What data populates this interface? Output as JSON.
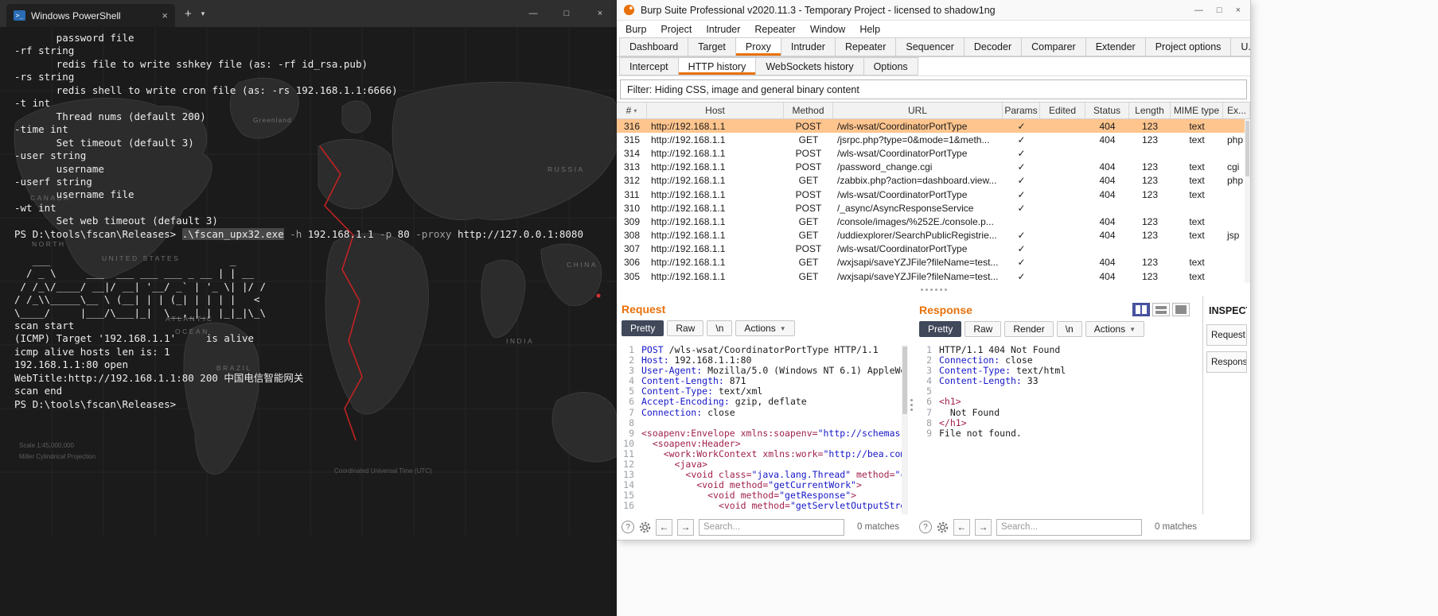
{
  "terminal": {
    "tab_bar": {
      "title": "Windows PowerShell",
      "ps_icon": ">_",
      "close": "×",
      "new_tab": "+",
      "dropdown": "▾",
      "controls": {
        "minimize": "—",
        "maximize": "□",
        "close": "×"
      }
    },
    "help_lines": [
      "       password file",
      "-rf string",
      "       redis file to write sshkey file (as: -rf id_rsa.pub)",
      "-rs string",
      "       redis shell to write cron file (as: -rs 192.168.1.1:6666)",
      "-t int",
      "       Thread nums (default 200)",
      "-time int",
      "       Set timeout (default 3)",
      "-user string",
      "       username",
      "-userf string",
      "       username file",
      "-wt int",
      "       Set web timeout (default 3)"
    ],
    "command_segments": [
      {
        "t": "PS D:\\tools\\fscan\\Releases> ",
        "c": "plain"
      },
      {
        "t": ".\\fscan_upx32.exe",
        "c": "cmd"
      },
      {
        "t": " ",
        "c": "plain"
      },
      {
        "t": "-h",
        "c": "param"
      },
      {
        "t": " 192.168.1.1 ",
        "c": "plain"
      },
      {
        "t": "-p",
        "c": "param"
      },
      {
        "t": " 80 ",
        "c": "plain"
      },
      {
        "t": "-proxy",
        "c": "param"
      },
      {
        "t": " http://127.0.0.1:8080",
        "c": "plain"
      }
    ],
    "banner_lines": [
      "",
      "   ___                              _",
      "  / _ \\     ___  ___ ___ ___ _ __ | | __",
      " / /_\\/____/ __|/ __| '__/ _` | '_ \\| |/ /",
      "/ /_\\\\_____\\__ \\ (__| | | (_| | | | |   < ",
      "\\____/     |___/\\___|_|  \\__,_|_| |_|_|\\_\\",
      ""
    ],
    "output_lines": [
      "scan start",
      "(ICMP) Target '192.168.1.1'     is alive",
      "icmp alive hosts len is: 1",
      "192.168.1.1:80 open",
      "WebTitle:http://192.168.1.1:80 200 中国电信智能网关",
      "scan end",
      "PS D:\\tools\\fscan\\Releases>"
    ],
    "map": {
      "labels": [
        "Greenland",
        "CANADA",
        "NORTH",
        "UNITED STATES",
        "RUSSIA",
        "CHINA",
        "INDIA",
        "BRAZIL",
        "ATLANTIC",
        "OCEAN"
      ],
      "captions": [
        "Scale 1:45,000,000",
        "Miller Cylindrical Projection",
        "Coordinated Universal Time (UTC)"
      ]
    }
  },
  "burp": {
    "title_bar": {
      "title": "Burp Suite Professional v2020.11.3 - Temporary Project - licensed to shadow1ng"
    },
    "window_controls": {
      "minimize": "—",
      "maximize": "□",
      "close": "×"
    },
    "menu": [
      "Burp",
      "Project",
      "Intruder",
      "Repeater",
      "Window",
      "Help"
    ],
    "main_tabs": [
      "Dashboard",
      "Target",
      "Proxy",
      "Intruder",
      "Repeater",
      "Sequencer",
      "Decoder",
      "Comparer",
      "Extender",
      "Project options",
      "U..."
    ],
    "sub_tabs": [
      "Intercept",
      "HTTP history",
      "WebSockets history",
      "Options"
    ],
    "filter_bar": "Filter: Hiding CSS, image and general binary content",
    "table": {
      "columns": [
        "#",
        "Host",
        "Method",
        "URL",
        "Params",
        "Edited",
        "Status",
        "Length",
        "MIME type",
        "Ex..."
      ],
      "rows": [
        {
          "num": "316",
          "host": "http://192.168.1.1",
          "method": "POST",
          "url": "/wls-wsat/CoordinatorPortType",
          "params": "✓",
          "edited": "",
          "status": "404",
          "length": "123",
          "mime": "text",
          "ext": "",
          "selected": true
        },
        {
          "num": "315",
          "host": "http://192.168.1.1",
          "method": "GET",
          "url": "/jsrpc.php?type=0&mode=1&meth...",
          "params": "✓",
          "edited": "",
          "status": "404",
          "length": "123",
          "mime": "text",
          "ext": "php",
          "selected": false
        },
        {
          "num": "314",
          "host": "http://192.168.1.1",
          "method": "POST",
          "url": "/wls-wsat/CoordinatorPortType",
          "params": "✓",
          "edited": "",
          "status": "",
          "length": "",
          "mime": "",
          "ext": "",
          "selected": false
        },
        {
          "num": "313",
          "host": "http://192.168.1.1",
          "method": "POST",
          "url": "/password_change.cgi",
          "params": "✓",
          "edited": "",
          "status": "404",
          "length": "123",
          "mime": "text",
          "ext": "cgi",
          "selected": false
        },
        {
          "num": "312",
          "host": "http://192.168.1.1",
          "method": "GET",
          "url": "/zabbix.php?action=dashboard.view...",
          "params": "✓",
          "edited": "",
          "status": "404",
          "length": "123",
          "mime": "text",
          "ext": "php",
          "selected": false
        },
        {
          "num": "311",
          "host": "http://192.168.1.1",
          "method": "POST",
          "url": "/wls-wsat/CoordinatorPortType",
          "params": "✓",
          "edited": "",
          "status": "404",
          "length": "123",
          "mime": "text",
          "ext": "",
          "selected": false
        },
        {
          "num": "310",
          "host": "http://192.168.1.1",
          "method": "POST",
          "url": "/_async/AsyncResponseService",
          "params": "✓",
          "edited": "",
          "status": "",
          "length": "",
          "mime": "",
          "ext": "",
          "selected": false
        },
        {
          "num": "309",
          "host": "http://192.168.1.1",
          "method": "GET",
          "url": "/console/images/%252E./console.p...",
          "params": "",
          "edited": "",
          "status": "404",
          "length": "123",
          "mime": "text",
          "ext": "",
          "selected": false
        },
        {
          "num": "308",
          "host": "http://192.168.1.1",
          "method": "GET",
          "url": "/uddiexplorer/SearchPublicRegistrie...",
          "params": "✓",
          "edited": "",
          "status": "404",
          "length": "123",
          "mime": "text",
          "ext": "jsp",
          "selected": false
        },
        {
          "num": "307",
          "host": "http://192.168.1.1",
          "method": "POST",
          "url": "/wls-wsat/CoordinatorPortType",
          "params": "✓",
          "edited": "",
          "status": "",
          "length": "",
          "mime": "",
          "ext": "",
          "selected": false
        },
        {
          "num": "306",
          "host": "http://192.168.1.1",
          "method": "GET",
          "url": "/wxjsapi/saveYZJFile?fileName=test...",
          "params": "✓",
          "edited": "",
          "status": "404",
          "length": "123",
          "mime": "text",
          "ext": "",
          "selected": false
        },
        {
          "num": "305",
          "host": "http://192.168.1.1",
          "method": "GET",
          "url": "/wxjsapi/saveYZJFile?fileName=test...",
          "params": "✓",
          "edited": "",
          "status": "404",
          "length": "123",
          "mime": "text",
          "ext": "",
          "selected": false
        }
      ]
    },
    "request": {
      "title": "Request",
      "tabs": {
        "pretty": "Pretty",
        "raw": "Raw",
        "nl": "\\n",
        "actions": "Actions"
      },
      "lines": [
        "POST /wls-wsat/CoordinatorPortType HTTP/1.1",
        "Host: 192.168.1.1:80",
        "User-Agent: Mozilla/5.0 (Windows NT 6.1) AppleWe",
        "Content-Length: 871",
        "Content-Type: text/xml",
        "Accept-Encoding: gzip, deflate",
        "Connection: close",
        "",
        "<soapenv:Envelope xmlns:soapenv=\"http://schemas.",
        "  <soapenv:Header>",
        "    <work:WorkContext xmlns:work=\"http://bea.com",
        "      <java>",
        "        <void class=\"java.lang.Thread\" method=\"c",
        "          <void method=\"getCurrentWork\">",
        "            <void method=\"getResponse\">",
        "              <void method=\"getServletOutputStre"
      ]
    },
    "response": {
      "title": "Response",
      "tabs": {
        "pretty": "Pretty",
        "raw": "Raw",
        "render": "Render",
        "nl": "\\n",
        "actions": "Actions"
      },
      "lines": [
        "HTTP/1.1 404 Not Found",
        "Connection: close",
        "Content-Type: text/html",
        "Content-Length: 33",
        "",
        "<h1>",
        "  Not Found",
        "</h1>",
        "File not found."
      ]
    },
    "inspector": {
      "title": "INSPECT...",
      "sections": [
        "Request att...",
        "Response..."
      ]
    },
    "search": {
      "placeholder": "Search...",
      "request_matches": "0 matches",
      "response_matches": "0 matches"
    }
  }
}
